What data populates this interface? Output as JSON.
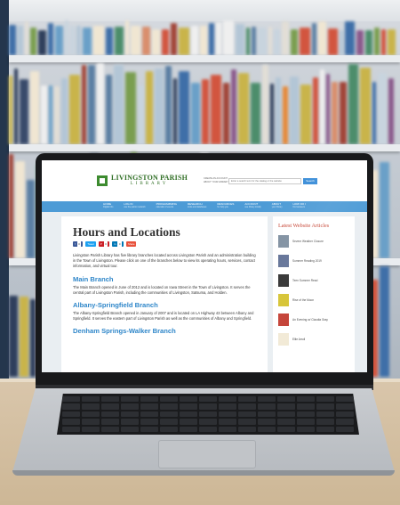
{
  "site": {
    "logo_line1": "LIVINGSTON PARISH",
    "logo_line2": "LIBRARY",
    "header_link1": "CREATE AN ACCOUNT",
    "header_link2": "ABOUT YOUR LIBRARY",
    "search_placeholder": "Enter a search term for the catalog or the website",
    "search_button": "Search"
  },
  "nav": [
    {
      "label": "HOME",
      "sub": "Digital info"
    },
    {
      "label": "LOG IN",
      "sub": "use the patron network"
    },
    {
      "label": "PROGRAMMING",
      "sub": "calendar of events"
    },
    {
      "label": "RESEARCH",
      "sub": "tools and databases"
    },
    {
      "label": "RESOURCES",
      "sub": "for help you"
    },
    {
      "label": "ACCOUNT",
      "sub": "see library locally"
    },
    {
      "label": "ABOUT",
      "sub": "your library"
    },
    {
      "label": "HOW DO I",
      "sub": "find answers"
    }
  ],
  "page": {
    "title": "Hours and Locations",
    "share": [
      {
        "label": "f",
        "count": "0",
        "color": "#3b5998"
      },
      {
        "label": "Tweet",
        "count": "",
        "color": "#1da1f2"
      },
      {
        "label": "P",
        "count": "0",
        "color": "#cb2027"
      },
      {
        "label": "in",
        "count": "0",
        "color": "#0077b5"
      },
      {
        "label": "Share",
        "count": "",
        "color": "#e8513b"
      }
    ],
    "intro": "Livingston Parish Library has five library branches located across Livingston Parish and an administration building in the Town of Livingston. Please click on one of the branches below to view its operating hours, services, contact information, and virtual tour.",
    "branches": [
      {
        "name": "Main Branch",
        "text": "The Main Branch opened in June of 2012 and is located on Iowa Street in the Town of Livingston. It serves the central part of Livingston Parish, including the communities of Livingston, Satsuma, and Holden."
      },
      {
        "name": "Albany-Springfield Branch",
        "text": "The Albany-Springfield Branch opened in January of 2007 and is located on LA Highway 43 between Albany and Springfield. It serves the eastern part of Livingston Parish as well as the communities of Albany and Springfield."
      },
      {
        "name": "Denham Springs-Walker Branch",
        "text": ""
      }
    ]
  },
  "sidebar": {
    "title": "Latest Website Articles",
    "articles": [
      {
        "label": "Severe Weather Closure",
        "color": "#7f8fa0"
      },
      {
        "label": "Summer Reading 2019",
        "color": "#5f6f94"
      },
      {
        "label": "Teen Summer Read",
        "color": "#2b2b2b"
      },
      {
        "label": "Rise of the Moon",
        "color": "#d4c12c"
      },
      {
        "label": "An Evening w/ Claudia Gray",
        "color": "#c23b30"
      },
      {
        "label": "Ellie Arroll",
        "color": "#f1e9d5"
      }
    ]
  }
}
